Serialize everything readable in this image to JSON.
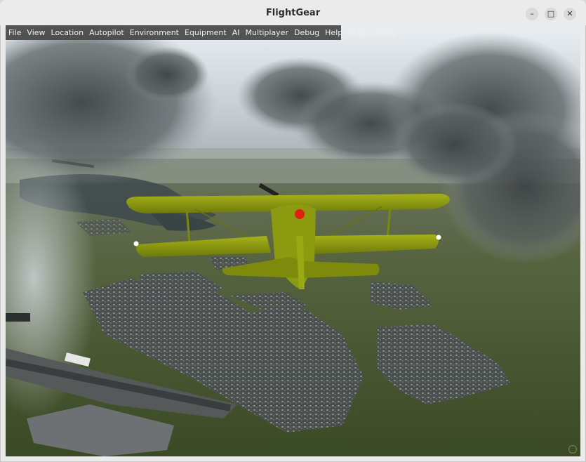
{
  "window": {
    "title": "FlightGear",
    "controls": [
      "minimize",
      "maximize",
      "close"
    ]
  },
  "menubar": {
    "items": [
      "File",
      "View",
      "Location",
      "Autopilot",
      "Environment",
      "Equipment",
      "AI",
      "Multiplayer",
      "Debug",
      "Help",
      "Staggerwing"
    ]
  },
  "scene": {
    "aircraft_color": "#8c9a10",
    "aircraft_marker_color": "#e02010"
  }
}
